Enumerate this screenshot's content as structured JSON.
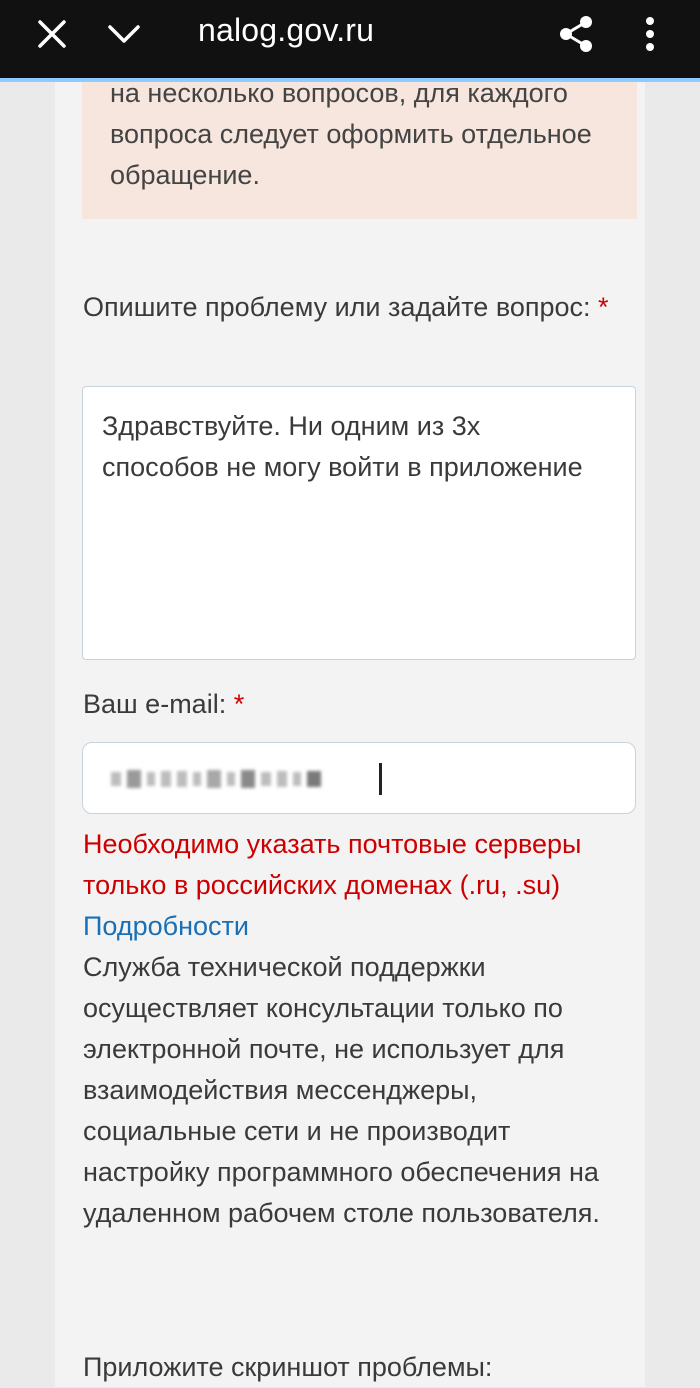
{
  "browser": {
    "url": "nalog.gov.ru",
    "close_icon": "close-icon",
    "chevron_icon": "chevron-down-icon",
    "share_icon": "share-icon",
    "more_icon": "more-vertical-icon"
  },
  "notice": {
    "text": "на несколько вопросов, для каждого вопроса следует оформить отдельное обращение."
  },
  "question": {
    "label": "Опишите проблему или задайте вопрос:",
    "required_mark": "*",
    "value": "Здравствуйте. Ни одним из 3х способов не могу войти в приложение"
  },
  "email": {
    "label": "Ваш e-mail:",
    "required_mark": "*"
  },
  "error": {
    "text": "Необходимо указать почтовые серверы только в российских доменах (.ru, .su)"
  },
  "details_link": "Подробности",
  "info": "Служба технической поддержки осуществляет консультации только по электронной почте, не использует для взаимодействия мессенджеры, социальные сети и не производит настройку программного обеспечения на удаленном рабочем столе пользователя.",
  "screenshot": {
    "label": "Приложите скриншот проблемы:"
  },
  "colors": {
    "error": "#cc0000",
    "link": "#1a6fb5",
    "notice_bg": "#f6e6de",
    "topbar": "#111111"
  }
}
